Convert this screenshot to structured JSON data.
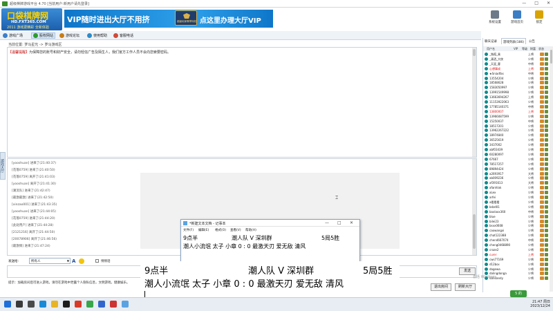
{
  "window": {
    "title": "超级棋牌游戏平台 4.70 [当前用户:新用户请先登录]",
    "minimize": "—",
    "maximize": "□",
    "close": "✕"
  },
  "banner": {
    "logo_main": "口袋棋牌网",
    "logo_url": "HD.FXT365.COM",
    "logo_slogan": "2011 游戏更精彩 全新体验",
    "ad_left": "VIP随时进出大厅不用挤",
    "ad_badge": "超级玩家尊享特权",
    "ad_right": "点这里办理大厅VIP"
  },
  "toolbar": {
    "buttons": [
      {
        "label": "系统设置",
        "icon": "gear-icon",
        "color": "#6c7a89"
      },
      {
        "label": "游戏首页",
        "icon": "home-icon",
        "color": "#3b7dc4"
      },
      {
        "label": "锁定",
        "icon": "lock-icon",
        "color": "#d9a300"
      },
      {
        "label": "帮助",
        "icon": "help-icon",
        "color": "#2f8f2f"
      }
    ]
  },
  "nav": {
    "items": [
      {
        "label": "游戏广场",
        "icon": "square-icon",
        "color": "#3c7ec9"
      },
      {
        "label": "股权网站",
        "icon": "site-icon",
        "color": "#2e9b2e"
      },
      {
        "label": "游戏论坛",
        "icon": "forum-icon",
        "color": "#c77d1a"
      },
      {
        "label": "使用帮助",
        "icon": "help-icon",
        "color": "#2d8bc9"
      },
      {
        "label": "客服电话",
        "icon": "phone-icon",
        "color": "#d04a3a"
      }
    ],
    "active_index": 1
  },
  "breadcrumb": "当前位置: 罗马星光 -> 罗马游戏区",
  "notice": {
    "prefix": "【温馨提醒】",
    "text": "为保障您的账号和财产安全，请勿轻信广告及陌生人，我们官方工作人员不会向您索要密码。"
  },
  "side_tab": "游戏大厅",
  "chat": {
    "lines": [
      "[yooshuan] 进来了(21:40:37)",
      "[花落0759] 进来了(21:40:50)",
      "[花落0759] 离开了(21:41:03)",
      "[yooshuan] 离开了(21:41:30)",
      "[潮流队] 进来了(21:42:47)",
      "[最激最激] 进来了(21:42:50)",
      "[xinzao001] 进来了(21:43:35)",
      "[yooshuan] 进来了(21:44:05)",
      "[花落0759] 进来了(21:44:20)",
      "[此处用户] 进来了(21:44:28)",
      "[2121216] 离开了(21:44:50)",
      "[20078906] 离开了(21:46:56)",
      "[最激情] 进来了(21:47:24)"
    ]
  },
  "send": {
    "label": "发送给:",
    "target": "所有人",
    "private_label": "悄悄话",
    "button": "发送"
  },
  "tip": "提示：加载房间后可进入游戏，请勿在游戏中泄露个人隐私信息，文明游戏，健康娱乐。",
  "actions": {
    "room_button": "退出房间",
    "hall_button": "刷新大厅"
  },
  "right_panel": {
    "tabs": [
      "聊天记录",
      "游戏列表(186)",
      "公告"
    ],
    "active_tab": 1,
    "columns": [
      "用户名",
      "VIP",
      "等级",
      "财富",
      "状态"
    ],
    "users": [
      {
        "name": "_独孤_乘",
        "level": "上将"
      },
      {
        "name": "_潇洒_大侠",
        "level": "少将"
      },
      {
        "name": "_天涯_客",
        "level": "中将"
      },
      {
        "name": "心想事成",
        "level": "上将",
        "highlight": true
      },
      {
        "name": "★Sniadfas",
        "level": "中将"
      },
      {
        "name": "13554204",
        "level": "少将"
      },
      {
        "name": "18568628",
        "level": "少将"
      },
      {
        "name": "1583050997",
        "level": "少将"
      },
      {
        "name": "13991549998",
        "level": "少将"
      },
      {
        "name": "13663694267",
        "level": "上将"
      },
      {
        "name": "11153922063",
        "level": "少将"
      },
      {
        "name": "17785140371",
        "level": "中将"
      },
      {
        "name": "13800007",
        "level": "上将",
        "highlight": true
      },
      {
        "name": "13966087599",
        "level": "少将"
      },
      {
        "name": "15250037",
        "level": "中将"
      },
      {
        "name": "18517201",
        "level": "少将"
      },
      {
        "name": "13962267222",
        "level": "少将"
      },
      {
        "name": "18974840",
        "level": "少将"
      },
      {
        "name": "36525619",
        "level": "少将"
      },
      {
        "name": "3437002",
        "level": "少将"
      },
      {
        "name": "abf03439",
        "level": "少将"
      },
      {
        "name": "60280097",
        "level": "少将"
      },
      {
        "name": "67667",
        "level": "少将"
      },
      {
        "name": "78517257",
        "level": "少将"
      },
      {
        "name": "89894424",
        "level": "少将"
      },
      {
        "name": "a2693917",
        "level": "大将"
      },
      {
        "name": "ab009236",
        "level": "少将"
      },
      {
        "name": "af391613",
        "level": "大将"
      },
      {
        "name": "afanhlak",
        "level": "少将"
      },
      {
        "name": "aLex",
        "level": "少将"
      },
      {
        "name": "arfei",
        "level": "少将"
      },
      {
        "name": "a看看看",
        "level": "少将"
      },
      {
        "name": "bdzd01",
        "level": "少将"
      },
      {
        "name": "baxlaxx360",
        "level": "中将"
      },
      {
        "name": "blue",
        "level": "少将"
      },
      {
        "name": "bilei23",
        "level": "少将"
      },
      {
        "name": "bsxx0608",
        "level": "少将"
      },
      {
        "name": "caowangxi",
        "level": "少将"
      },
      {
        "name": "chat122388",
        "level": "少将"
      },
      {
        "name": "chen4667074",
        "level": "中将"
      },
      {
        "name": "cheng0468890",
        "level": "少将"
      },
      {
        "name": "craze2",
        "level": "少将"
      },
      {
        "name": "curer",
        "level": "上将",
        "highlight": true
      },
      {
        "name": "cws77169",
        "level": "少将"
      },
      {
        "name": "d12bsx",
        "level": "少将"
      },
      {
        "name": "dagewa",
        "level": "少将"
      },
      {
        "name": "dalingdonga",
        "level": "少将"
      },
      {
        "name": "dandandy",
        "level": "少将"
      }
    ]
  },
  "notepad": {
    "title": "*新建文本文档 - 记事本",
    "menu": [
      "文件(F)",
      "编辑(E)",
      "格式(O)",
      "查看(V)",
      "帮助(H)"
    ],
    "line1_left": "9点半",
    "line1_mid": "潮人队 V 深圳群",
    "line1_right": "5局5胜",
    "line2": "潮人小流氓  太子  小章    0  :  0   最激天刃  爱无敌  清风"
  },
  "overlay": {
    "line1_left": "9点半",
    "line1_mid": "潮人队 V 深圳群",
    "line1_right": "5局5胜",
    "line2": "潮人小流氓  太子  小章    0  :  0   最激天刃  爱无敌  清风"
  },
  "watermark": "激活 Windows",
  "float_badge": "5 的",
  "taskbar": {
    "time": "21:47",
    "day": "周日",
    "date": "2023/12/24",
    "icons": [
      {
        "name": "windows-start-icon",
        "color": "#1e6fd9"
      },
      {
        "name": "search-icon",
        "color": "#3a3a3a"
      },
      {
        "name": "task-view-icon",
        "color": "#4a4a4a"
      },
      {
        "name": "edge-icon",
        "color": "#1a8ad6"
      },
      {
        "name": "folder-icon",
        "color": "#e8b425"
      },
      {
        "name": "qq-icon",
        "color": "#1c1c1c"
      },
      {
        "name": "game-icon",
        "color": "#d83a2a"
      },
      {
        "name": "chrome-icon",
        "color": "#3aa64a"
      },
      {
        "name": "app-icon",
        "color": "#3366cc"
      },
      {
        "name": "media-icon",
        "color": "#cc3333"
      },
      {
        "name": "notepad-icon",
        "color": "#5ba3e0"
      }
    ]
  }
}
